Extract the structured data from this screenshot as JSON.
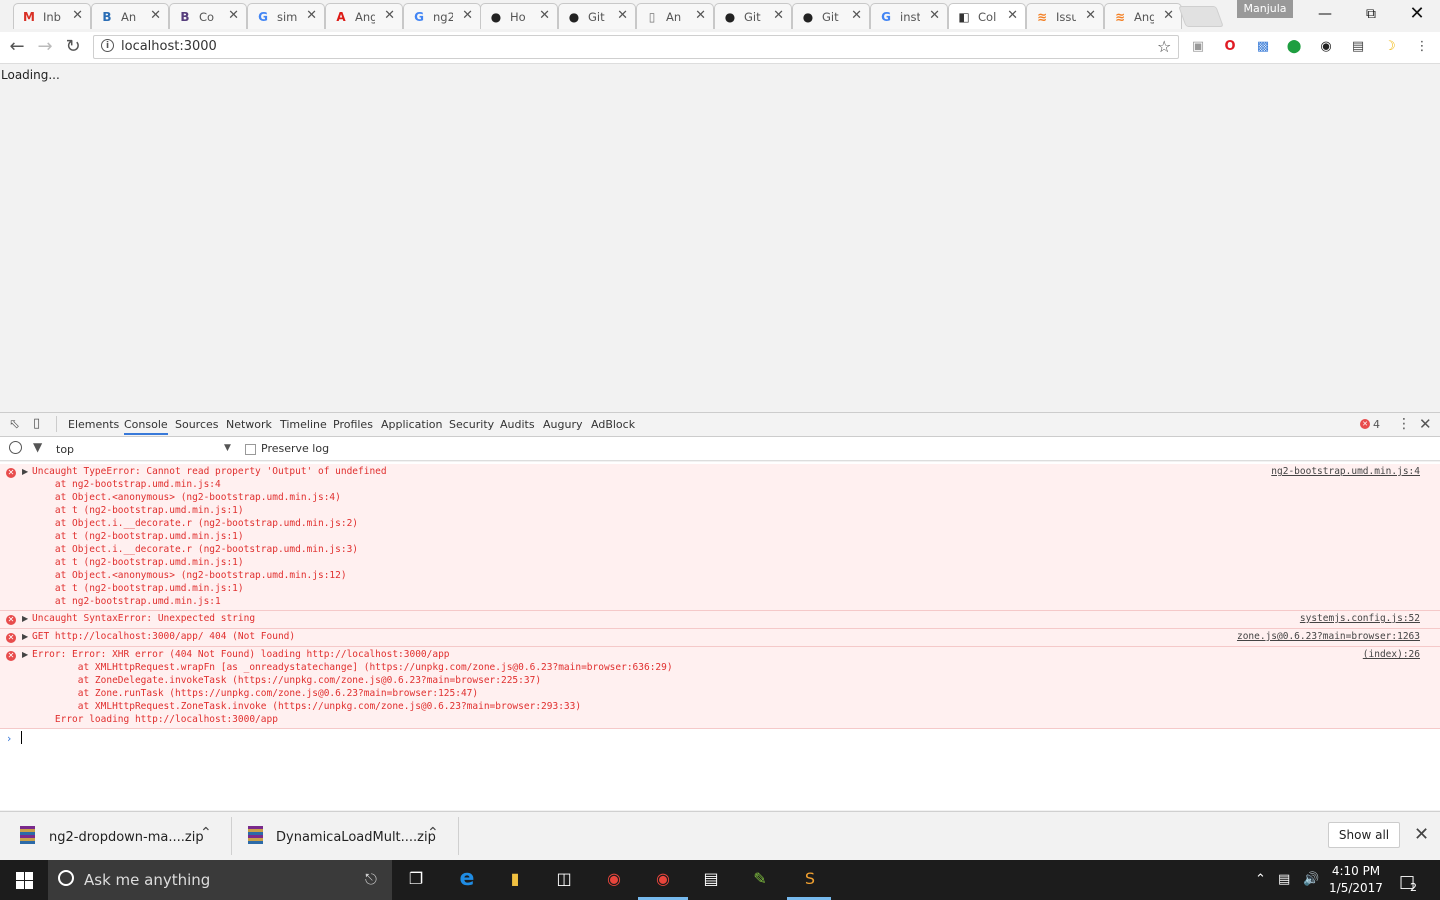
{
  "browser": {
    "tabs": [
      {
        "icon": "gmail-icon",
        "icon_char": "M",
        "icon_color": "#d93025",
        "label": "Inb"
      },
      {
        "icon": "bootstrap-icon",
        "icon_char": "B",
        "icon_color": "#2a6db5",
        "label": "An"
      },
      {
        "icon": "bootstrap-icon",
        "icon_char": "B",
        "icon_color": "#563d7c",
        "label": "Co"
      },
      {
        "icon": "google-icon",
        "icon_char": "G",
        "icon_color": "#4285f4",
        "label": "sim"
      },
      {
        "icon": "angular-icon",
        "icon_char": "A",
        "icon_color": "#dd1b16",
        "label": "Ang"
      },
      {
        "icon": "google-icon",
        "icon_char": "G",
        "icon_color": "#4285f4",
        "label": "ng2"
      },
      {
        "icon": "github-icon",
        "icon_char": "●",
        "icon_color": "#222",
        "label": "Ho"
      },
      {
        "icon": "github-icon",
        "icon_char": "●",
        "icon_color": "#222",
        "label": "Git"
      },
      {
        "icon": "document-icon",
        "icon_char": "▯",
        "icon_color": "#777",
        "label": "An"
      },
      {
        "icon": "github-icon",
        "icon_char": "●",
        "icon_color": "#222",
        "label": "Git"
      },
      {
        "icon": "github-icon",
        "icon_char": "●",
        "icon_color": "#222",
        "label": "Git"
      },
      {
        "icon": "google-icon",
        "icon_char": "G",
        "icon_color": "#4285f4",
        "label": "inst"
      },
      {
        "icon": "plunker-icon",
        "icon_char": "◧",
        "icon_color": "#333",
        "label": "Col",
        "active": true
      },
      {
        "icon": "stackoverflow-icon",
        "icon_char": "≋",
        "icon_color": "#f48024",
        "label": "Issu"
      },
      {
        "icon": "stackoverflow-icon",
        "icon_char": "≋",
        "icon_color": "#f48024",
        "label": "Ang"
      }
    ],
    "profile_name": "Manjula",
    "url": "localhost:3000"
  },
  "page": {
    "loading_text": "Loading..."
  },
  "devtools": {
    "tabs": [
      "Elements",
      "Console",
      "Sources",
      "Network",
      "Timeline",
      "Profiles",
      "Application",
      "Security",
      "Audits",
      "Augury",
      "AdBlock"
    ],
    "active_tab": "Console",
    "error_count": "4",
    "context": "top",
    "preserve_log_label": "Preserve log",
    "errors": [
      {
        "lines": [
          "Uncaught TypeError: Cannot read property 'Output' of undefined",
          "    at ng2-bootstrap.umd.min.js:4",
          "    at Object.<anonymous> (ng2-bootstrap.umd.min.js:4)",
          "    at t (ng2-bootstrap.umd.min.js:1)",
          "    at Object.i.__decorate.r (ng2-bootstrap.umd.min.js:2)",
          "    at t (ng2-bootstrap.umd.min.js:1)",
          "    at Object.i.__decorate.r (ng2-bootstrap.umd.min.js:3)",
          "    at t (ng2-bootstrap.umd.min.js:1)",
          "    at Object.<anonymous> (ng2-bootstrap.umd.min.js:12)",
          "    at t (ng2-bootstrap.umd.min.js:1)",
          "    at ng2-bootstrap.umd.min.js:1"
        ],
        "source": "ng2-bootstrap.umd.min.js:4"
      },
      {
        "lines": [
          "Uncaught SyntaxError: Unexpected string"
        ],
        "source": "systemjs.config.js:52"
      },
      {
        "lines": [
          "GET http://localhost:3000/app/ 404 (Not Found)"
        ],
        "source": "zone.js@0.6.23?main=browser:1263"
      },
      {
        "lines": [
          "Error: Error: XHR error (404 Not Found) loading http://localhost:3000/app",
          "        at XMLHttpRequest.wrapFn [as _onreadystatechange] (https://unpkg.com/zone.js@0.6.23?main=browser:636:29)",
          "        at ZoneDelegate.invokeTask (https://unpkg.com/zone.js@0.6.23?main=browser:225:37)",
          "        at Zone.runTask (https://unpkg.com/zone.js@0.6.23?main=browser:125:47)",
          "        at XMLHttpRequest.ZoneTask.invoke (https://unpkg.com/zone.js@0.6.23?main=browser:293:33)",
          "    Error loading http://localhost:3000/app"
        ],
        "source": "(index):26"
      }
    ]
  },
  "downloads": {
    "items": [
      {
        "name": "ng2-dropdown-ma....zip"
      },
      {
        "name": "DynamicaLoadMult....zip"
      }
    ],
    "show_all_label": "Show all"
  },
  "taskbar": {
    "search_placeholder": "Ask me anything",
    "time": "4:10 PM",
    "date": "1/5/2017",
    "notification_count": "2"
  }
}
